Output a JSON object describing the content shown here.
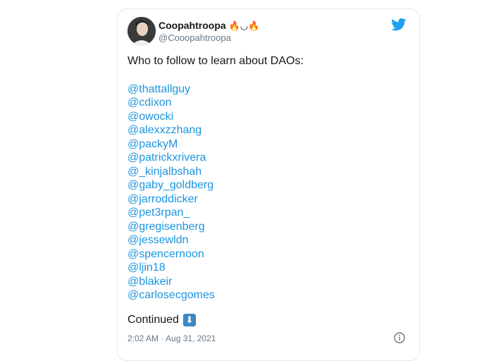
{
  "tweet": {
    "display_name": "Coopahtroopa",
    "emoji": "🔥◡🔥",
    "handle": "@Cooopahtroopa",
    "intro": "Who to follow to learn about DAOs:",
    "mentions": [
      "@thattallguy",
      "@cdixon",
      "@owocki",
      "@alexxzzhang",
      "@packyM",
      "@patrickxrivera",
      "@_kinjalbshah",
      "@gaby_goldberg",
      "@jarroddicker",
      "@pet3rpan_",
      "@gregisenberg",
      "@jessewldn",
      "@spencernoon",
      "@ljin18",
      "@blakeir",
      "@carlosecgomes"
    ],
    "continued": "Continued",
    "arrow_emoji": "⬇",
    "timestamp": "2:02 AM · Aug 31, 2021"
  },
  "icons": {
    "brand": "twitter-bird-icon",
    "info": "info-icon"
  },
  "colors": {
    "link": "#1b95e0",
    "twitter_blue": "#1da1f2",
    "text": "#14171a",
    "secondary": "#657786"
  }
}
